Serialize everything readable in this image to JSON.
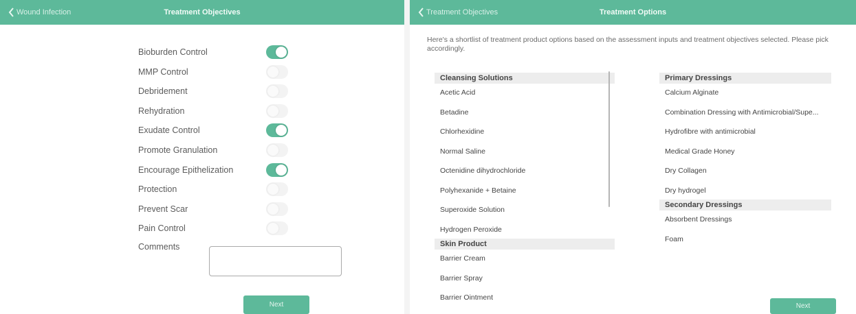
{
  "left": {
    "back_label": "Wound Infection",
    "title": "Treatment Objectives",
    "objectives": [
      {
        "label": "Bioburden Control",
        "on": true
      },
      {
        "label": "MMP Control",
        "on": false
      },
      {
        "label": "Debridement",
        "on": false
      },
      {
        "label": "Rehydration",
        "on": false
      },
      {
        "label": "Exudate Control",
        "on": true
      },
      {
        "label": "Promote Granulation",
        "on": false
      },
      {
        "label": "Encourage Epithelization",
        "on": true
      },
      {
        "label": "Protection",
        "on": false
      },
      {
        "label": "Prevent Scar",
        "on": false
      },
      {
        "label": "Pain Control",
        "on": false
      }
    ],
    "comments_label": "Comments",
    "comments_value": "",
    "next_label": "Next"
  },
  "right": {
    "back_label": "Treatment Objectives",
    "title": "Treatment Options",
    "intro": "Here's a shortlist of treatment product options based on the assessment inputs and treatment objectives selected. Please pick accordingly.",
    "left_column": [
      {
        "header": "Cleansing Solutions",
        "items": [
          "Acetic Acid",
          "Betadine",
          "Chlorhexidine",
          "Normal Saline",
          "Octenidine dihydrochloride",
          "Polyhexanide + Betaine",
          "Superoxide Solution",
          "Hydrogen Peroxide"
        ]
      },
      {
        "header": "Skin Product",
        "items": [
          "Barrier Cream",
          "Barrier Spray",
          "Barrier Ointment"
        ]
      }
    ],
    "right_column": [
      {
        "header": "Primary Dressings",
        "items": [
          "Calcium Alginate",
          "Combination Dressing with Antimicrobial/Supe...",
          "Hydrofibre with antimicrobial",
          "Medical Grade Honey",
          "Dry Collagen",
          "Dry hydrogel"
        ]
      },
      {
        "header": "Secondary Dressings",
        "items": [
          "Absorbent Dressings",
          "Foam"
        ]
      }
    ],
    "next_label": "Next"
  },
  "colors": {
    "accent": "#5db99a",
    "toggle_off": "#f3f3f3",
    "section_bg": "#ededed"
  }
}
